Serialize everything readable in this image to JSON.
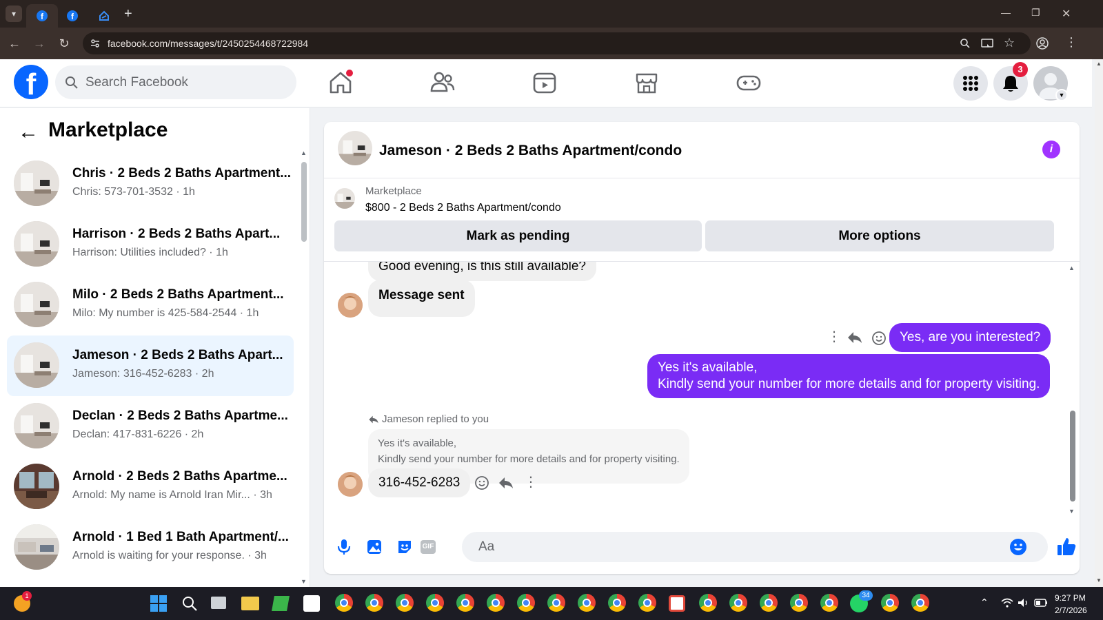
{
  "browser": {
    "url": "facebook.com/messages/t/2450254468722984"
  },
  "header": {
    "search_placeholder": "Search Facebook",
    "notification_count": "3"
  },
  "sidebar": {
    "title": "Marketplace",
    "conversations": [
      {
        "name": "Chris · 2 Beds 2 Baths Apartment...",
        "preview": "Chris: 573-701-3532 · 1h"
      },
      {
        "name": "Harrison · 2 Beds 2 Baths Apart...",
        "preview": "Harrison: Utilities included? · 1h"
      },
      {
        "name": "Milo · 2 Beds 2 Baths Apartment...",
        "preview": "Milo: My number is 425-584-2544 · 1h"
      },
      {
        "name": "Jameson · 2 Beds 2 Baths Apart...",
        "preview": "Jameson: 316-452-6283 · 2h"
      },
      {
        "name": "Declan · 2 Beds 2 Baths Apartme...",
        "preview": "Declan: 417-831-6226 · 2h"
      },
      {
        "name": "Arnold · 2 Beds 2 Baths Apartme...",
        "preview": "Arnold: My name is Arnold Iran Mir...  · 3h"
      },
      {
        "name": "Arnold · 1 Bed 1 Bath Apartment/...",
        "preview": "Arnold is waiting for your response. · 3h"
      }
    ]
  },
  "chat": {
    "title": "Jameson · 2 Beds 2 Baths Apartment/condo",
    "marketplace_label": "Marketplace",
    "listing": "$800 - 2 Beds 2 Baths Apartment/condo",
    "mark_pending": "Mark as pending",
    "more_options": "More options",
    "messages": {
      "partial_in": "Good evening, is this still available?",
      "sent_notice": "Message sent",
      "out1": "Yes, are you interested?",
      "out2_line1": "Yes it's available,",
      "out2_line2": "Kindly send your number for more details and for property visiting.",
      "replied_label": "Jameson replied to you",
      "quoted_line1": "Yes it's available,",
      "quoted_line2": "Kindly send your number for more details and for property visiting.",
      "reply": "316-452-6283"
    },
    "composer_placeholder": "Aa"
  },
  "taskbar": {
    "time": "9:27 PM",
    "date": "2/7/2026",
    "whatsapp_badge": "34",
    "weather_badge": "1"
  },
  "colors": {
    "fb_blue": "#0866ff",
    "messenger_purple": "#7a2cf5",
    "selected_bg": "#ebf5ff",
    "badge_red": "#e41e3f"
  }
}
